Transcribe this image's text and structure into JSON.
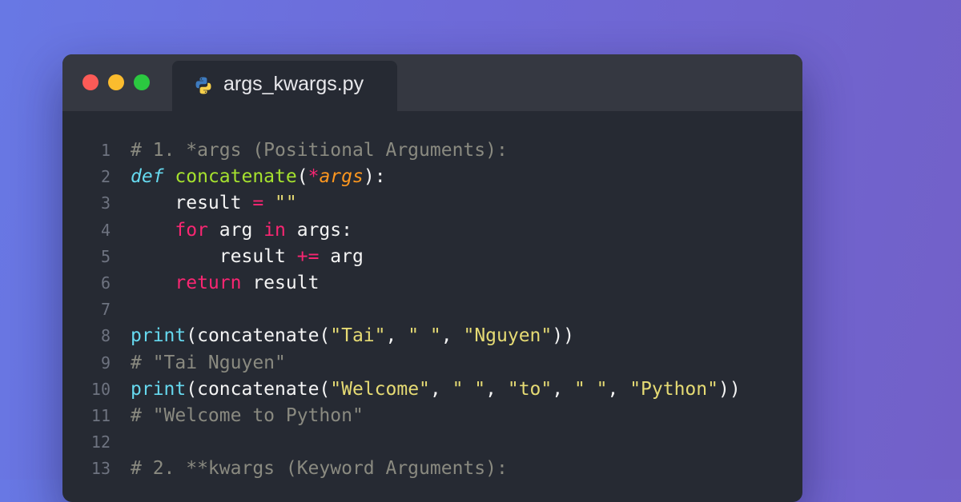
{
  "window": {
    "tab": {
      "filename": "args_kwargs.py",
      "icon": "python-icon"
    },
    "controls": [
      "close-button",
      "minimize-button",
      "maximize-button"
    ]
  },
  "colors": {
    "comment": "#8a8a80",
    "keyword": "#f92672",
    "def_keyword": "#66d9ef",
    "function_name": "#a6e22e",
    "string": "#e6db74",
    "parameter": "#fd971f",
    "plain": "#f4f4f4"
  },
  "editor": {
    "lines": [
      {
        "number": "1",
        "tokens": [
          {
            "t": "# 1. *args (Positional Arguments):",
            "k": "comment"
          }
        ]
      },
      {
        "number": "2",
        "tokens": [
          {
            "t": "def",
            "k": "keyword-def"
          },
          {
            "t": " ",
            "k": "plain"
          },
          {
            "t": "concatenate",
            "k": "funcname"
          },
          {
            "t": "(",
            "k": "plain"
          },
          {
            "t": "*",
            "k": "star"
          },
          {
            "t": "args",
            "k": "param"
          },
          {
            "t": "):",
            "k": "plain"
          }
        ]
      },
      {
        "number": "3",
        "tokens": [
          {
            "t": "    result ",
            "k": "plain"
          },
          {
            "t": "=",
            "k": "operator"
          },
          {
            "t": " ",
            "k": "plain"
          },
          {
            "t": "\"\"",
            "k": "string"
          }
        ]
      },
      {
        "number": "4",
        "tokens": [
          {
            "t": "    ",
            "k": "plain"
          },
          {
            "t": "for",
            "k": "keyword"
          },
          {
            "t": " arg ",
            "k": "plain"
          },
          {
            "t": "in",
            "k": "keyword"
          },
          {
            "t": " args:",
            "k": "plain"
          }
        ]
      },
      {
        "number": "5",
        "tokens": [
          {
            "t": "        result ",
            "k": "plain"
          },
          {
            "t": "+=",
            "k": "operator"
          },
          {
            "t": " arg",
            "k": "plain"
          }
        ]
      },
      {
        "number": "6",
        "tokens": [
          {
            "t": "    ",
            "k": "plain"
          },
          {
            "t": "return",
            "k": "keyword"
          },
          {
            "t": " result",
            "k": "plain"
          }
        ]
      },
      {
        "number": "7",
        "tokens": []
      },
      {
        "number": "8",
        "tokens": [
          {
            "t": "print",
            "k": "builtin"
          },
          {
            "t": "(concatenate(",
            "k": "plain"
          },
          {
            "t": "\"Tai\"",
            "k": "string"
          },
          {
            "t": ", ",
            "k": "plain"
          },
          {
            "t": "\" \"",
            "k": "string"
          },
          {
            "t": ", ",
            "k": "plain"
          },
          {
            "t": "\"Nguyen\"",
            "k": "string"
          },
          {
            "t": "))",
            "k": "plain"
          }
        ]
      },
      {
        "number": "9",
        "tokens": [
          {
            "t": "# \"Tai Nguyen\"",
            "k": "comment"
          }
        ]
      },
      {
        "number": "10",
        "tokens": [
          {
            "t": "print",
            "k": "builtin"
          },
          {
            "t": "(concatenate(",
            "k": "plain"
          },
          {
            "t": "\"Welcome\"",
            "k": "string"
          },
          {
            "t": ", ",
            "k": "plain"
          },
          {
            "t": "\" \"",
            "k": "string"
          },
          {
            "t": ", ",
            "k": "plain"
          },
          {
            "t": "\"to\"",
            "k": "string"
          },
          {
            "t": ", ",
            "k": "plain"
          },
          {
            "t": "\" \"",
            "k": "string"
          },
          {
            "t": ", ",
            "k": "plain"
          },
          {
            "t": "\"Python\"",
            "k": "string"
          },
          {
            "t": "))",
            "k": "plain"
          }
        ]
      },
      {
        "number": "11",
        "tokens": [
          {
            "t": "# \"Welcome to Python\"",
            "k": "comment"
          }
        ]
      },
      {
        "number": "12",
        "tokens": []
      },
      {
        "number": "13",
        "tokens": [
          {
            "t": "# 2. **kwargs (Keyword Arguments):",
            "k": "comment"
          }
        ]
      }
    ]
  }
}
